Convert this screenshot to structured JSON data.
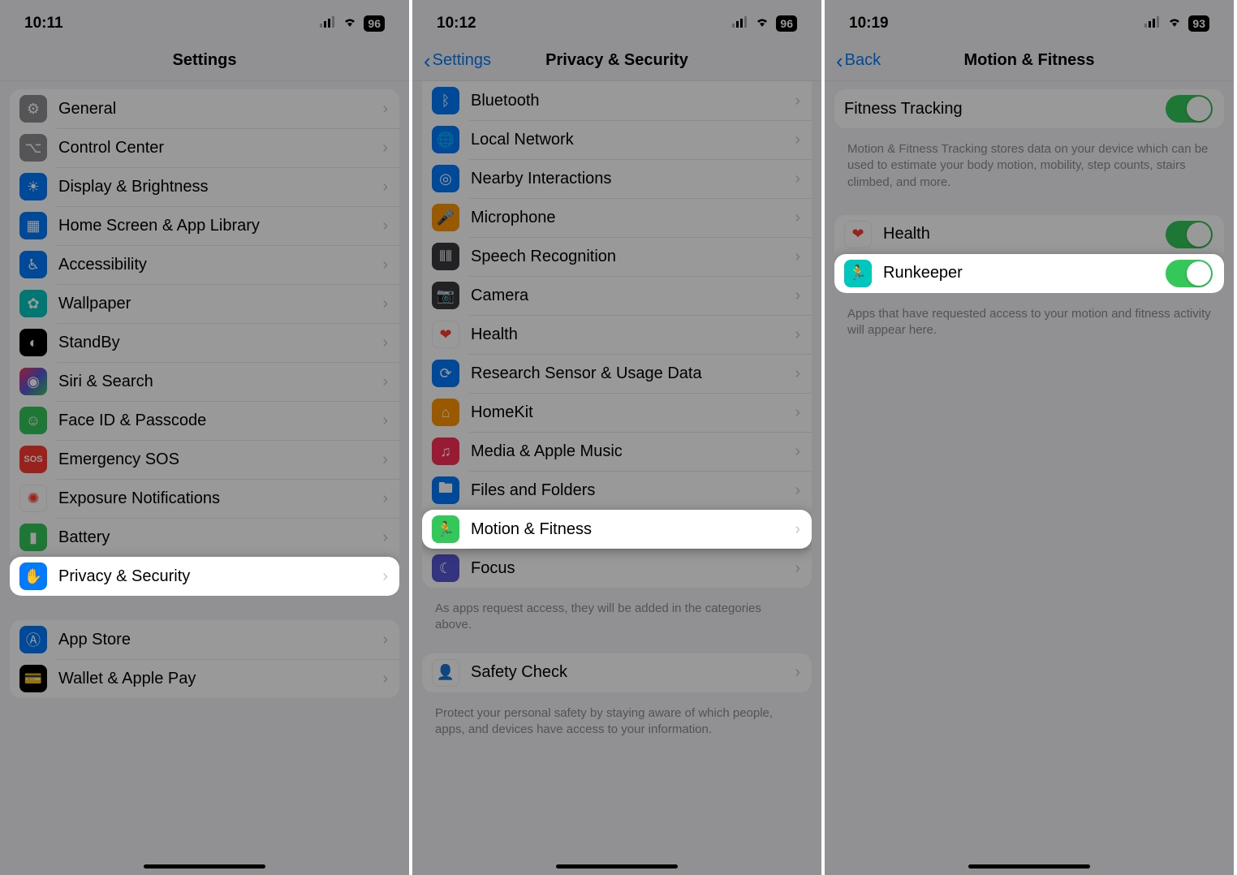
{
  "screen1": {
    "time": "10:11",
    "battery": "96",
    "title": "Settings",
    "group1": [
      {
        "label": "General"
      },
      {
        "label": "Control Center"
      },
      {
        "label": "Display & Brightness"
      },
      {
        "label": "Home Screen & App Library"
      },
      {
        "label": "Accessibility"
      },
      {
        "label": "Wallpaper"
      },
      {
        "label": "StandBy"
      },
      {
        "label": "Siri & Search"
      },
      {
        "label": "Face ID & Passcode"
      },
      {
        "label": "Emergency SOS"
      },
      {
        "label": "Exposure Notifications"
      },
      {
        "label": "Battery"
      },
      {
        "label": "Privacy & Security"
      }
    ],
    "group2": [
      {
        "label": "App Store"
      },
      {
        "label": "Wallet & Apple Pay"
      }
    ]
  },
  "screen2": {
    "time": "10:12",
    "battery": "96",
    "back": "Settings",
    "title": "Privacy & Security",
    "items": [
      {
        "label": "Bluetooth"
      },
      {
        "label": "Local Network"
      },
      {
        "label": "Nearby Interactions"
      },
      {
        "label": "Microphone"
      },
      {
        "label": "Speech Recognition"
      },
      {
        "label": "Camera"
      },
      {
        "label": "Health"
      },
      {
        "label": "Research Sensor & Usage Data"
      },
      {
        "label": "HomeKit"
      },
      {
        "label": "Media & Apple Music"
      },
      {
        "label": "Files and Folders"
      },
      {
        "label": "Motion & Fitness"
      },
      {
        "label": "Focus"
      }
    ],
    "footer1": "As apps request access, they will be added in the categories above.",
    "safety": "Safety Check",
    "footer2": "Protect your personal safety by staying aware of which people, apps, and devices have access to your information."
  },
  "screen3": {
    "time": "10:19",
    "battery": "93",
    "back": "Back",
    "title": "Motion & Fitness",
    "fitness_tracking": "Fitness Tracking",
    "fitness_desc": "Motion & Fitness Tracking stores data on your device which can be used to estimate your body motion, mobility, step counts, stairs climbed, and more.",
    "health": "Health",
    "runkeeper": "Runkeeper",
    "apps_desc": "Apps that have requested access to your motion and fitness activity will appear here."
  }
}
